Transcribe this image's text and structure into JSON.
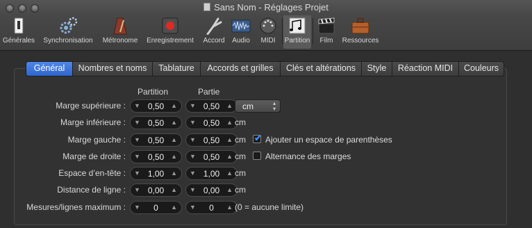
{
  "window": {
    "title": "Sans Nom - Réglages Projet"
  },
  "toolbar": {
    "items": [
      {
        "label": "Générales",
        "icon": "switch-icon"
      },
      {
        "label": "Synchronisation",
        "icon": "gears-icon"
      },
      {
        "label": "Métronome",
        "icon": "metronome-icon"
      },
      {
        "label": "Enregistrement",
        "icon": "record-icon"
      },
      {
        "label": "Accord",
        "icon": "tuning-fork-icon"
      },
      {
        "label": "Audio",
        "icon": "waveform-icon"
      },
      {
        "label": "MIDI",
        "icon": "midi-port-icon"
      },
      {
        "label": "Partition",
        "icon": "score-notes-icon"
      },
      {
        "label": "Film",
        "icon": "clapperboard-icon"
      },
      {
        "label": "Ressources",
        "icon": "briefcase-icon"
      }
    ],
    "selected": "Partition"
  },
  "tabs": [
    {
      "label": "Général",
      "active": true
    },
    {
      "label": "Nombres et noms"
    },
    {
      "label": "Tablature"
    },
    {
      "label": "Accords et grilles"
    },
    {
      "label": "Clés et altérations"
    },
    {
      "label": "Style"
    },
    {
      "label": "Réaction MIDI"
    },
    {
      "label": "Couleurs"
    }
  ],
  "columns": {
    "partition": "Partition",
    "partie": "Partie"
  },
  "rows": [
    {
      "label": "Marge supérieure :",
      "partition": "0,50",
      "partie": "0,50"
    },
    {
      "label": "Marge inférieure :",
      "partition": "0,50",
      "partie": "0,50",
      "unit": "cm"
    },
    {
      "label": "Marge gauche :",
      "partition": "0,50",
      "partie": "0,50",
      "unit": "cm"
    },
    {
      "label": "Marge de droite :",
      "partition": "0,50",
      "partie": "0,50",
      "unit": "cm"
    },
    {
      "label": "Espace d’en-tête :",
      "partition": "1,00",
      "partie": "1,00",
      "unit": "cm"
    },
    {
      "label": "Distance de ligne :",
      "partition": "0,00",
      "partie": "0,00",
      "unit": "cm"
    },
    {
      "label": "Mesures/lignes maximum :",
      "partition": "0",
      "partie": "0",
      "unit": "(0 = aucune limite)"
    }
  ],
  "unit_select": {
    "value": "cm"
  },
  "options": {
    "parentheses": {
      "label": "Ajouter un espace de parenthèses",
      "checked": true
    },
    "alternating_margins": {
      "label": "Alternance des marges",
      "checked": false
    }
  },
  "glyphs": {
    "down": "▼",
    "up": "▲",
    "check": "✔",
    "select_arrows": "▴▾"
  },
  "colors": {
    "accent": "#2f66cd",
    "background": "#2f2f2f"
  }
}
